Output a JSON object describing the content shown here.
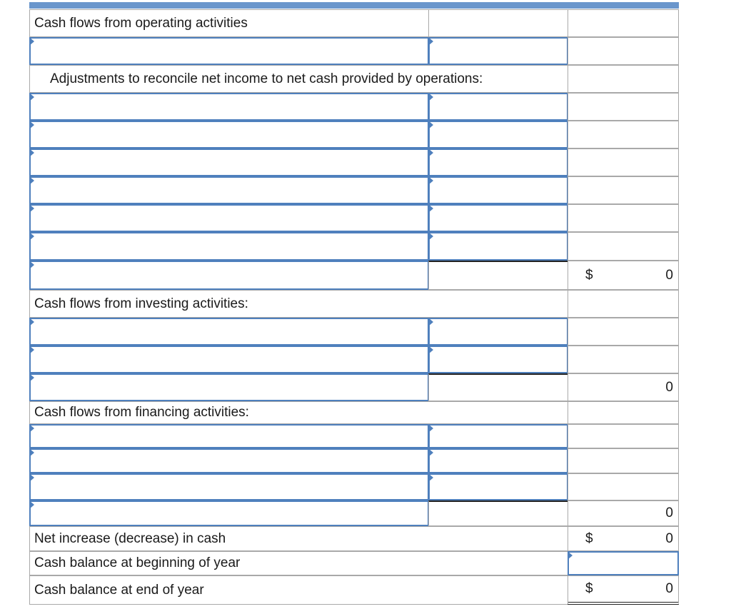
{
  "colors": {
    "input_border": "#4f80bd",
    "top_bar": "#6a96cc",
    "grid": "#a9a9a9"
  },
  "sections": {
    "operating_label": "Cash flows from operating activities",
    "adjustments_label": "Adjustments to reconcile net income to net cash provided by operations:",
    "investing_label": "Cash flows from investing activities:",
    "financing_label": "Cash flows from financing activities:"
  },
  "subtotals": {
    "operating": {
      "currency": "$",
      "value": "0"
    },
    "investing": {
      "value": "0"
    },
    "financing": {
      "value": "0"
    }
  },
  "summary": {
    "net_change_label": "Net increase (decrease) in cash",
    "net_change_currency": "$",
    "net_change_value": "0",
    "beginning_label": "Cash balance at beginning of year",
    "ending_label": "Cash balance at end of year",
    "ending_currency": "$",
    "ending_value": "0"
  }
}
